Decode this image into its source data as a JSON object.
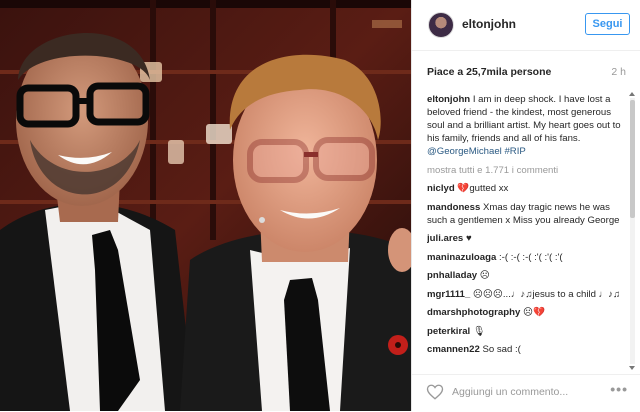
{
  "post": {
    "username": "eltonjohn",
    "follow_label": "Segui",
    "likes_text": "Piace a 25,7mila persone",
    "age": "2 h",
    "caption_user": "eltonjohn",
    "caption_text": "I am in deep shock. I have lost a beloved friend - the kindest, most generous soul and a brilliant artist. My heart goes out to his family, friends and all of his fans.",
    "caption_tags": "@GeorgeMichael #RIP",
    "show_all_comments": "mostra tutti e 1.771 i commenti",
    "add_comment_placeholder": "Aggiungi un commento...",
    "more_icon": "ellipsis-icon",
    "like_icon": "heart-icon"
  },
  "comments": [
    {
      "user": "niclyd",
      "text": "💔gutted xx"
    },
    {
      "user": "mandoness",
      "text": "Xmas day tragic news he was such a gentlemen x Miss you already George"
    },
    {
      "user": "juli.ares",
      "text": "♥"
    },
    {
      "user": "maninazuloaga",
      "text": ":-( :-( :-( :'( :'( :'("
    },
    {
      "user": "pnhalladay",
      "text": "☹"
    },
    {
      "user": "mgr1111_",
      "text": "☹☹☹...♩♪♫jesus to a child ♩♪♫"
    },
    {
      "user": "dmarshphotography",
      "text": "☹💔"
    },
    {
      "user": "peterkiral",
      "text": "🎙"
    },
    {
      "user": "cmannen22",
      "text": "So sad :("
    }
  ],
  "colors": {
    "accent": "#3897f0",
    "link": "#2b5a83",
    "muted": "#999999"
  }
}
